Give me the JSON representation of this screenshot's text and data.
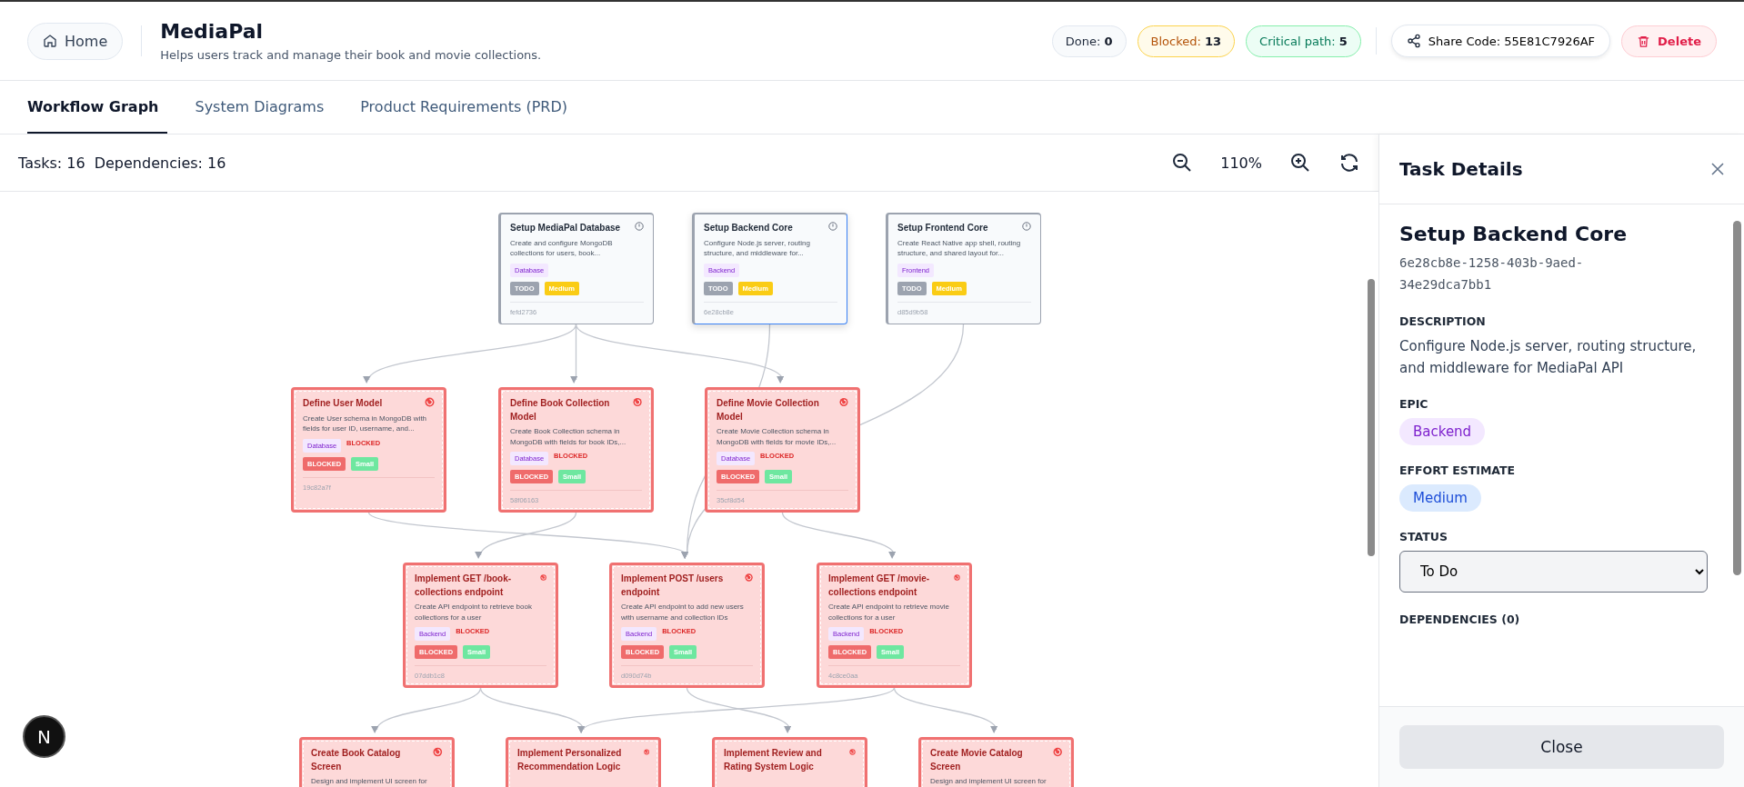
{
  "header": {
    "home_button": "Home",
    "title": "MediaPal",
    "subtitle": "Helps users track and manage their book and movie collections.",
    "stats": [
      {
        "kind": "done",
        "label": "Done:",
        "value": "0"
      },
      {
        "kind": "blocked",
        "label": "Blocked:",
        "value": "13"
      },
      {
        "kind": "critical",
        "label": "Critical path:",
        "value": "5"
      }
    ],
    "share_button": "Share Code: 55E81C7926AF",
    "delete_button": "Delete"
  },
  "tabs": [
    {
      "label": "Workflow Graph",
      "selected": true
    },
    {
      "label": "System Diagrams",
      "selected": false
    },
    {
      "label": "Product Requirements (PRD)",
      "selected": false
    }
  ],
  "toolbar": {
    "tasks": "Tasks: 16",
    "dependencies": "Dependencies: 16",
    "zoom": "110%"
  },
  "nodes": [
    {
      "title": "Setup MediaPal Database",
      "description": "Create and configure MongoDB collections for users, book...",
      "epic": "Database",
      "kind": "todo",
      "status": "TODO",
      "effort": {
        "label": "Medium",
        "color": "#facc15"
      },
      "id": "fefd2736",
      "selected": false
    },
    {
      "title": "Setup Backend Core",
      "description": "Configure Node.js server, routing structure, and middleware for...",
      "epic": "Backend",
      "kind": "todo",
      "status": "TODO",
      "effort": {
        "label": "Medium",
        "color": "#facc15"
      },
      "id": "6e28cb8e",
      "selected": true
    },
    {
      "title": "Setup Frontend Core",
      "description": "Create React Native app shell, routing structure, and shared layout for...",
      "epic": "Frontend",
      "kind": "todo",
      "status": "TODO",
      "effort": {
        "label": "Medium",
        "color": "#facc15"
      },
      "id": "d85d9b58",
      "selected": false
    },
    {
      "title": "Define User Model",
      "description": "Create User schema in MongoDB with fields for user ID, username, and...",
      "epic": "Database",
      "kind": "blocked",
      "blocked_label": "BLOCKED",
      "status": "BLOCKED",
      "effort": {
        "label": "Small",
        "color": "#6ee7a0"
      },
      "id": "19c82a7f",
      "selected": false
    },
    {
      "title": "Define Book Collection Model",
      "description": "Create Book Collection schema in MongoDB with fields for book IDs,...",
      "epic": "Database",
      "kind": "blocked",
      "blocked_label": "BLOCKED",
      "status": "BLOCKED",
      "effort": {
        "label": "Small",
        "color": "#6ee7a0"
      },
      "id": "58f06163",
      "selected": false
    },
    {
      "title": "Define Movie Collection Model",
      "description": "Create Movie Collection schema in MongoDB with fields for movie IDs,...",
      "epic": "Database",
      "kind": "blocked",
      "blocked_label": "BLOCKED",
      "status": "BLOCKED",
      "effort": {
        "label": "Small",
        "color": "#6ee7a0"
      },
      "id": "35cf8d54",
      "selected": false
    },
    {
      "title": "Implement GET /book-collections endpoint",
      "description": "Create API endpoint to retrieve book collections for a user",
      "epic": "Backend",
      "kind": "blocked",
      "blocked_label": "BLOCKED",
      "status": "BLOCKED",
      "effort": {
        "label": "Small",
        "color": "#6ee7a0"
      },
      "id": "07ddb1c8",
      "selected": false
    },
    {
      "title": "Implement POST /users endpoint",
      "description": "Create API endpoint to add new users with username and collection IDs",
      "epic": "Backend",
      "kind": "blocked",
      "blocked_label": "BLOCKED",
      "status": "BLOCKED",
      "effort": {
        "label": "Small",
        "color": "#6ee7a0"
      },
      "id": "d090d74b",
      "selected": false
    },
    {
      "title": "Implement GET /movie-collections endpoint",
      "description": "Create API endpoint to retrieve movie collections for a user",
      "epic": "Backend",
      "kind": "blocked",
      "blocked_label": "BLOCKED",
      "status": "BLOCKED",
      "effort": {
        "label": "Small",
        "color": "#6ee7a0"
      },
      "id": "4c8ce0aa",
      "selected": false
    },
    {
      "title": "Create Book Catalog Screen",
      "description": "Design and implement UI screen for",
      "kind": "blocked",
      "selected": false
    },
    {
      "title": "Implement Personalized Recommendation Logic",
      "kind": "blocked",
      "selected": false
    },
    {
      "title": "Implement Review and Rating System Logic",
      "kind": "blocked",
      "selected": false
    },
    {
      "title": "Create Movie Catalog Screen",
      "description": "Design and implement UI screen for",
      "kind": "blocked",
      "selected": false
    }
  ],
  "dev_badge": "N",
  "task_details": {
    "heading": "Task Details",
    "title": "Setup Backend Core",
    "uuid": "6e28cb8e-1258-403b-9aed-34e29dca7bb1",
    "description_label": "DESCRIPTION",
    "description": "Configure Node.js server, routing structure, and middleware for MediaPal API",
    "epic_label": "EPIC",
    "epic": "Backend",
    "effort_label": "EFFORT ESTIMATE",
    "effort": "Medium",
    "status_label": "STATUS",
    "status": "To Do",
    "dependencies_label": "DEPENDENCIES (0)",
    "close_button": "Close"
  }
}
